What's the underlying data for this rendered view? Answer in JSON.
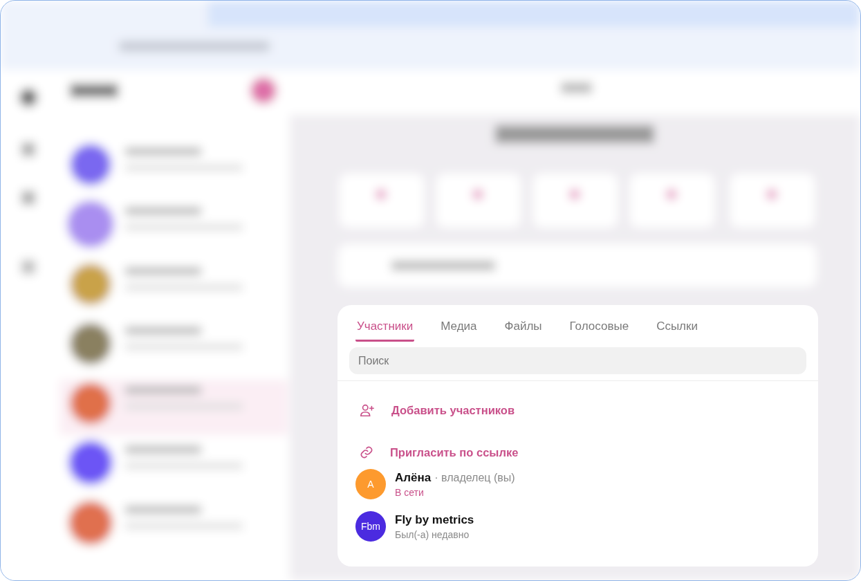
{
  "members_panel": {
    "tabs": [
      {
        "label": "Участники",
        "selected": true
      },
      {
        "label": "Медиа",
        "selected": false
      },
      {
        "label": "Файлы",
        "selected": false
      },
      {
        "label": "Голосовые",
        "selected": false
      },
      {
        "label": "Ссылки",
        "selected": false
      }
    ],
    "search": {
      "placeholder": "Поиск"
    },
    "actions": [
      {
        "kind": "add",
        "label": "Добавить участников"
      },
      {
        "kind": "link",
        "label": "Пригласить по ссылке"
      }
    ],
    "members": [
      {
        "avatar": "A",
        "color": "#fd9a2e",
        "name": "Алёна",
        "role": "· владелец (вы)",
        "status": "В сети",
        "online": true
      },
      {
        "avatar": "Fbm",
        "color": "#4b2be0",
        "name": "Fly by metrics",
        "status": "Был(-а) недавно",
        "online": false
      }
    ]
  }
}
